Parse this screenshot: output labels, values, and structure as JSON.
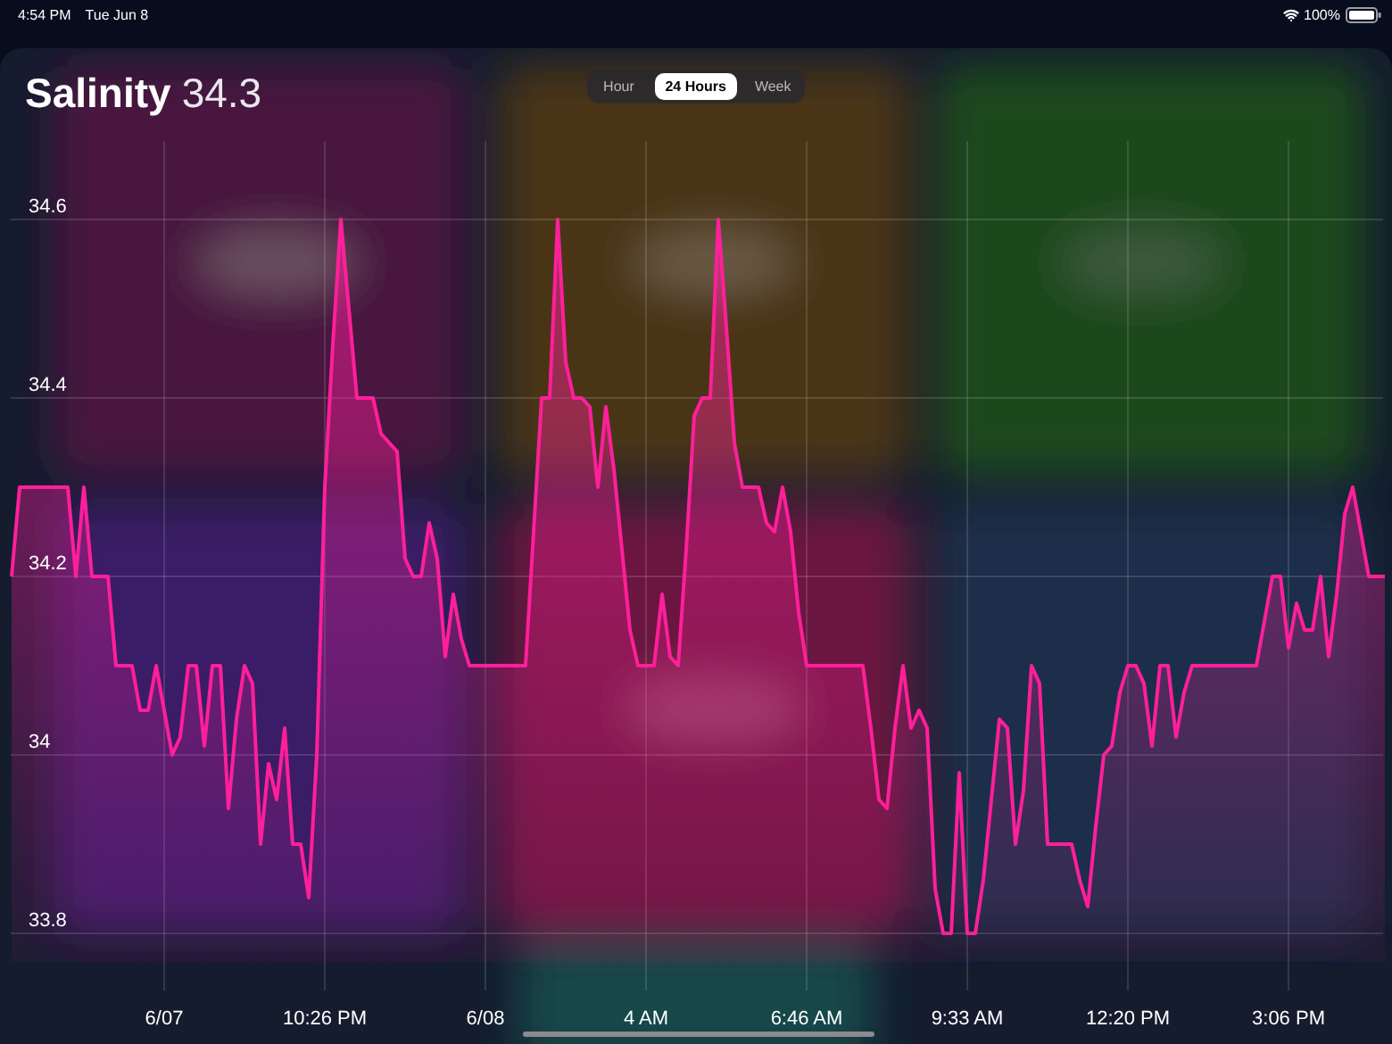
{
  "status_bar": {
    "time": "4:54 PM",
    "date": "Tue Jun 8",
    "battery": "100%"
  },
  "header": {
    "title": "Salinity",
    "value": "34.3"
  },
  "range_tabs": [
    {
      "label": "Hour",
      "selected": false
    },
    {
      "label": "24 Hours",
      "selected": true
    },
    {
      "label": "Week",
      "selected": false
    }
  ],
  "chart": {
    "chart_data": {
      "type": "area",
      "grid": true,
      "ylim": [
        33.67,
        34.84
      ],
      "yticks": [
        33.8,
        34,
        34.2,
        34.4,
        34.6
      ],
      "categories": [
        null,
        null,
        null,
        null,
        null,
        null,
        null,
        null,
        null,
        null,
        null,
        null,
        null,
        null,
        null,
        null,
        null,
        null,
        null,
        "6/07",
        null,
        null,
        null,
        null,
        null,
        null,
        null,
        null,
        null,
        null,
        null,
        null,
        null,
        null,
        null,
        null,
        null,
        null,
        null,
        "10:26 PM",
        null,
        null,
        null,
        null,
        null,
        null,
        null,
        null,
        null,
        null,
        null,
        null,
        null,
        null,
        null,
        null,
        null,
        null,
        null,
        "6/08",
        null,
        null,
        null,
        null,
        null,
        null,
        null,
        null,
        null,
        null,
        null,
        null,
        null,
        null,
        null,
        null,
        null,
        null,
        null,
        "4 AM",
        null,
        null,
        null,
        null,
        null,
        null,
        null,
        null,
        null,
        null,
        null,
        null,
        null,
        null,
        null,
        null,
        null,
        null,
        null,
        "6:46 AM",
        null,
        null,
        null,
        null,
        null,
        null,
        null,
        null,
        null,
        null,
        null,
        null,
        null,
        null,
        null,
        null,
        null,
        null,
        null,
        "9:33 AM",
        null,
        null,
        null,
        null,
        null,
        null,
        null,
        null,
        null,
        null,
        null,
        null,
        null,
        null,
        null,
        null,
        null,
        null,
        null,
        "12:20 PM",
        null,
        null,
        null,
        null,
        null,
        null,
        null,
        null,
        null,
        null,
        null,
        null,
        null,
        null,
        null,
        null,
        null,
        null,
        null,
        "3:06 PM",
        null,
        null,
        null,
        null,
        null,
        null,
        null,
        null,
        null,
        null,
        null,
        null
      ],
      "series": [
        {
          "color": "#ff1f9a",
          "values": [
            34.2,
            34.3,
            34.3,
            34.3,
            34.3,
            34.3,
            34.3,
            34.3,
            34.2,
            34.3,
            34.2,
            34.2,
            34.2,
            34.1,
            34.1,
            34.1,
            34.05,
            34.05,
            34.1,
            34.05,
            34.0,
            34.02,
            34.1,
            34.1,
            34.01,
            34.1,
            34.1,
            33.94,
            34.04,
            34.1,
            34.08,
            33.9,
            33.99,
            33.95,
            34.03,
            33.9,
            33.9,
            33.84,
            34.0,
            34.3,
            34.46,
            34.6,
            34.5,
            34.4,
            34.4,
            34.4,
            34.36,
            34.35,
            34.34,
            34.22,
            34.2,
            34.2,
            34.26,
            34.22,
            34.11,
            34.18,
            34.13,
            34.1,
            34.1,
            34.1,
            34.1,
            34.1,
            34.1,
            34.1,
            34.1,
            34.25,
            34.4,
            34.4,
            34.6,
            34.44,
            34.4,
            34.4,
            34.39,
            34.3,
            34.39,
            34.32,
            34.23,
            34.14,
            34.1,
            34.1,
            34.1,
            34.18,
            34.11,
            34.1,
            34.23,
            34.38,
            34.4,
            34.4,
            34.6,
            34.48,
            34.35,
            34.3,
            34.3,
            34.3,
            34.26,
            34.25,
            34.3,
            34.25,
            34.16,
            34.1,
            34.1,
            34.1,
            34.1,
            34.1,
            34.1,
            34.1,
            34.1,
            34.03,
            33.95,
            33.94,
            34.03,
            34.1,
            34.03,
            34.05,
            34.03,
            33.85,
            33.8,
            33.8,
            33.98,
            33.8,
            33.8,
            33.86,
            33.95,
            34.04,
            34.03,
            33.9,
            33.96,
            34.1,
            34.08,
            33.9,
            33.9,
            33.9,
            33.9,
            33.86,
            33.83,
            33.92,
            34.0,
            34.01,
            34.07,
            34.1,
            34.1,
            34.08,
            34.01,
            34.1,
            34.1,
            34.02,
            34.07,
            34.1,
            34.1,
            34.1,
            34.1,
            34.1,
            34.1,
            34.1,
            34.1,
            34.1,
            34.15,
            34.2,
            34.2,
            34.12,
            34.17,
            34.14,
            34.14,
            34.2,
            34.11,
            34.18,
            34.27,
            34.3,
            34.25,
            34.2,
            34.2,
            34.2
          ]
        }
      ]
    }
  }
}
